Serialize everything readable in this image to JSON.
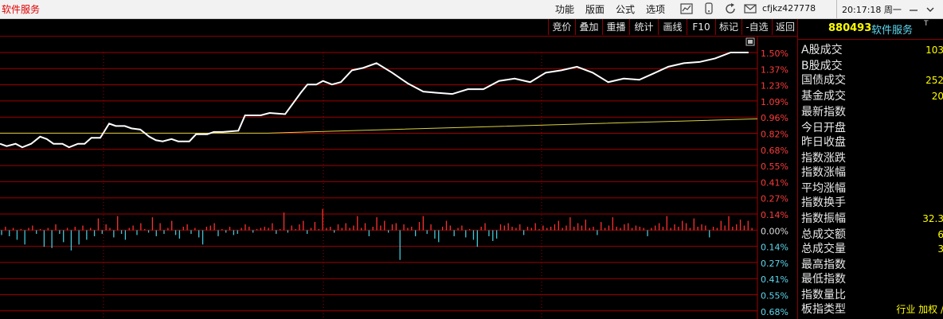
{
  "app": {
    "title": "软件服务"
  },
  "menu": [
    {
      "label": "功能"
    },
    {
      "label": "版面"
    },
    {
      "label": "公式"
    },
    {
      "label": "选项"
    }
  ],
  "titlebar_icons": [
    "chart-line-icon",
    "device-icon",
    "refresh-icon",
    "mail-icon"
  ],
  "user": {
    "name": "cfjkz427778"
  },
  "clock": {
    "text": "20:17:18 周一"
  },
  "toolbar": {
    "buttons": [
      {
        "label": "竞价"
      },
      {
        "label": "叠加"
      },
      {
        "label": "重播"
      },
      {
        "label": "统计"
      },
      {
        "label": "画线"
      },
      {
        "label": "F10"
      },
      {
        "label": "标记"
      },
      {
        "label": "-自选"
      },
      {
        "label": "返回"
      }
    ]
  },
  "side": {
    "code": "880493",
    "name": "软件服务",
    "mark": "T",
    "rows": [
      {
        "label": "A股成交",
        "value": "103"
      },
      {
        "label": "B股成交",
        "value": ""
      },
      {
        "label": "国债成交",
        "value": "252"
      },
      {
        "label": "基金成交",
        "value": "20"
      },
      {
        "label": "最新指数",
        "value": ""
      },
      {
        "label": "今日开盘",
        "value": ""
      },
      {
        "label": "昨日收盘",
        "value": ""
      },
      {
        "label": "指数涨跌",
        "value": ""
      },
      {
        "label": "指数涨幅",
        "value": ""
      },
      {
        "label": "平均涨幅",
        "value": ""
      },
      {
        "label": "指数换手",
        "value": ""
      },
      {
        "label": "指数振幅",
        "value": "32.3"
      },
      {
        "label": "总成交额",
        "value": "6"
      },
      {
        "label": "总成交量",
        "value": "3"
      },
      {
        "label": "最高指数",
        "value": ""
      },
      {
        "label": "最低指数",
        "value": ""
      },
      {
        "label": "指数量比",
        "value": ""
      },
      {
        "label": "板指类型",
        "value": "行业 加权 /"
      }
    ]
  },
  "colors": {
    "grid": "#a00000",
    "price_line": "#ffffff",
    "avg_line": "#d8d040",
    "up_bar": "#ff3030",
    "down_bar": "#40c8d8",
    "axis_label": "#ff3c3c",
    "zero_label": "#dddddd",
    "down_label": "#5fd8f0"
  },
  "chart_data": {
    "type": "line",
    "ylabel_ticks": [
      "1.50%",
      "1.37%",
      "1.23%",
      "1.09%",
      "0.96%",
      "0.82%",
      "0.68%",
      "0.55%",
      "0.41%",
      "0.27%",
      "0.14%",
      "0.00%",
      "0.14%",
      "0.27%",
      "0.41%",
      "0.55%",
      "0.68%"
    ],
    "ylim": [
      -0.68,
      1.5
    ],
    "price_series": {
      "x": [
        0,
        3,
        7,
        10,
        14,
        18,
        21,
        24,
        28,
        31,
        35,
        38,
        41,
        45,
        49,
        52,
        56,
        59,
        63,
        67,
        70,
        73,
        77,
        80,
        85,
        88,
        93,
        96,
        100,
        107,
        110,
        117,
        121,
        128,
        135,
        138,
        142,
        145,
        149,
        153,
        158,
        163,
        169,
        176,
        183,
        190,
        196,
        203,
        210,
        217,
        224,
        231,
        238,
        245,
        252,
        259,
        266,
        273,
        280,
        287,
        293,
        300,
        307,
        314,
        321,
        328,
        336
      ],
      "y": [
        0.73,
        0.71,
        0.73,
        0.7,
        0.73,
        0.79,
        0.77,
        0.73,
        0.73,
        0.7,
        0.73,
        0.73,
        0.78,
        0.78,
        0.9,
        0.88,
        0.88,
        0.86,
        0.85,
        0.79,
        0.76,
        0.75,
        0.77,
        0.75,
        0.75,
        0.81,
        0.81,
        0.83,
        0.83,
        0.84,
        0.97,
        0.97,
        0.99,
        0.98,
        1.16,
        1.23,
        1.23,
        1.26,
        1.23,
        1.25,
        1.35,
        1.37,
        1.41,
        1.33,
        1.24,
        1.17,
        1.16,
        1.15,
        1.19,
        1.19,
        1.26,
        1.28,
        1.25,
        1.33,
        1.35,
        1.38,
        1.33,
        1.25,
        1.28,
        1.27,
        1.32,
        1.38,
        1.41,
        1.42,
        1.45,
        1.5,
        1.5
      ]
    },
    "avg_series": {
      "x": [
        0,
        120,
        340
      ],
      "y": [
        0.82,
        0.82,
        0.94
      ]
    },
    "volume_series": {
      "values": [
        -0.04,
        0.03,
        -0.05,
        0.02,
        -0.08,
        0.01,
        -0.12,
        0.02,
        0.04,
        -0.03,
        0.01,
        -0.14,
        0.02,
        -0.15,
        0.05,
        -0.03,
        -0.1,
        0.02,
        -0.17,
        0.03,
        -0.12,
        0.04,
        -0.08,
        0.02,
        -0.05,
        0.1,
        -0.03,
        0.05,
        0.02,
        -0.06,
        0.12,
        -0.03,
        -0.08,
        0.02,
        0.04,
        -0.04,
        0.06,
        0.01,
        -0.02,
        0.11,
        -0.05,
        0.06,
        -0.03,
        0.02,
        0.08,
        -0.04,
        -0.07,
        0.03,
        0.05,
        -0.03,
        0.02,
        -0.06,
        -0.12,
        0.03,
        0.04,
        0.06,
        -0.05,
        0.01,
        -0.02,
        0.03,
        -0.04,
        -0.03,
        0.02,
        0.05,
        0.03,
        -0.02,
        0.01,
        0.02,
        0.03,
        0.02,
        0.06,
        -0.03,
        0.01,
        0.15,
        -0.02,
        0.04,
        0.01,
        0.05,
        0.08,
        -0.03,
        0.02,
        0.07,
        0.01,
        0.18,
        0.02,
        0.03,
        -0.02,
        0.05,
        0.02,
        0.06,
        0.02,
        0.04,
        0.12,
        0.02,
        0.06,
        -0.05,
        0.03,
        0.11,
        0.04,
        0.08,
        -0.02,
        0.05,
        0.06,
        -0.25,
        0.05,
        0.02,
        0.03,
        -0.05,
        0.07,
        0.12,
        -0.03,
        0.05,
        -0.07,
        -0.1,
        0.03,
        0.08,
        0.04,
        -0.05,
        0.02,
        0.04,
        -0.06,
        0.01,
        -0.08,
        -0.14,
        0.03,
        0.06,
        -0.05,
        -0.09,
        -0.07,
        0.05,
        0.04,
        0.06,
        0.03,
        0.02,
        0.05,
        -0.04,
        0.03,
        0.02,
        0.06,
        0.01,
        0.04,
        0.02,
        0.03,
        0.05,
        0.08,
        0.02,
        0.04,
        0.11,
        0.03,
        0.06,
        0.04,
        0.09,
        0.02,
        0.03,
        -0.04,
        0.07,
        0.02,
        0.04,
        0.11,
        0.03,
        0.02,
        0.05,
        0.06,
        0.02,
        0.04,
        0.03,
        0.02,
        -0.05,
        0.02,
        0.04,
        0.06,
        0.03,
        0.12,
        0.02,
        0.05,
        0.03,
        0.08,
        0.06,
        0.02,
        0.1,
        0.03,
        0.05,
        0.04,
        -0.06,
        0.03,
        0.02,
        0.08,
        0.04,
        0.12,
        0.03,
        0.05,
        0.09,
        0.04,
        0.08,
        0.02
      ]
    }
  }
}
